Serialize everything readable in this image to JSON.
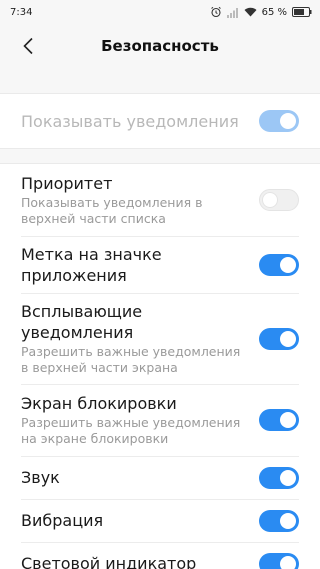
{
  "status_bar": {
    "time": "7:34",
    "battery": "65 %"
  },
  "header": {
    "title": "Безопасность"
  },
  "main_toggle": {
    "label": "Показывать уведомления",
    "state": "on-disabled"
  },
  "settings": [
    {
      "title": "Приоритет",
      "subtitle": "Показывать уведомления в верхней части списка",
      "state": "off"
    },
    {
      "title": "Метка на значке приложения",
      "subtitle": "",
      "state": "on"
    },
    {
      "title": "Всплывающие уведомления",
      "subtitle": "Разрешить важные уведомления в верхней части экрана",
      "state": "on"
    },
    {
      "title": "Экран блокировки",
      "subtitle": "Разрешить важные уведомления на экране блокировки",
      "state": "on"
    },
    {
      "title": "Звук",
      "subtitle": "",
      "state": "on"
    },
    {
      "title": "Вибрация",
      "subtitle": "",
      "state": "on"
    },
    {
      "title": "Световой индикатор",
      "subtitle": "",
      "state": "on"
    }
  ],
  "colors": {
    "accent": "#2a8bf2",
    "accent_disabled": "#9cc7f5",
    "background": "#f7f7f7"
  }
}
